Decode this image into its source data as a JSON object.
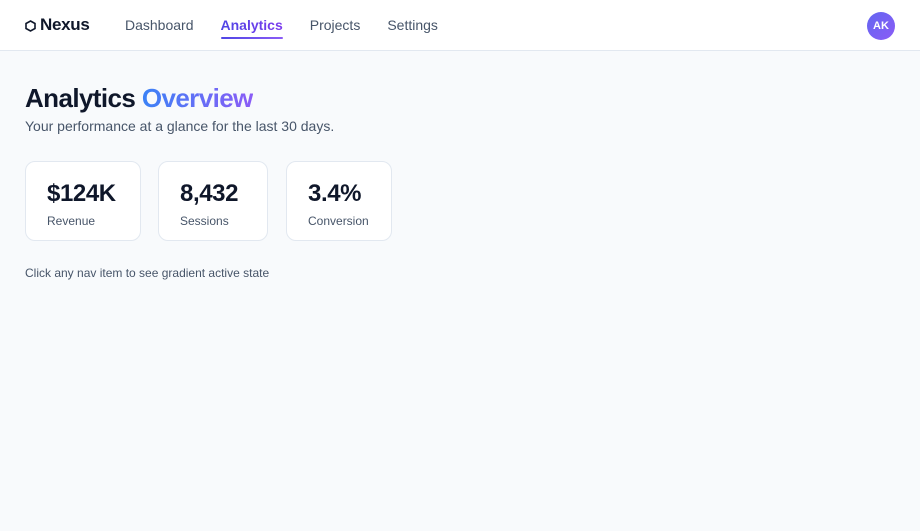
{
  "brand": {
    "name": "Nexus",
    "icon": "hexagon-icon"
  },
  "nav": {
    "items": [
      {
        "label": "Dashboard"
      },
      {
        "label": "Analytics"
      },
      {
        "label": "Projects"
      },
      {
        "label": "Settings"
      }
    ],
    "active_index": 1
  },
  "user": {
    "initials": "AK"
  },
  "page": {
    "title": "Analytics",
    "title_accent": "Overview",
    "subtitle": "Your performance at a glance for the last 30 days."
  },
  "stats": [
    {
      "value": "$124K",
      "label": "Revenue"
    },
    {
      "value": "8,432",
      "label": "Sessions"
    },
    {
      "value": "3.4%",
      "label": "Conversion"
    }
  ],
  "hint": "Click any nav item to see gradient active state",
  "colors": {
    "accent_start": "#4f46e5",
    "accent_end": "#8b5cf6",
    "title_accent_start": "#3b82f6",
    "background": "#f8fafc",
    "card_border": "#e2e8f0",
    "text_primary": "#0f172a",
    "text_secondary": "#475569"
  }
}
